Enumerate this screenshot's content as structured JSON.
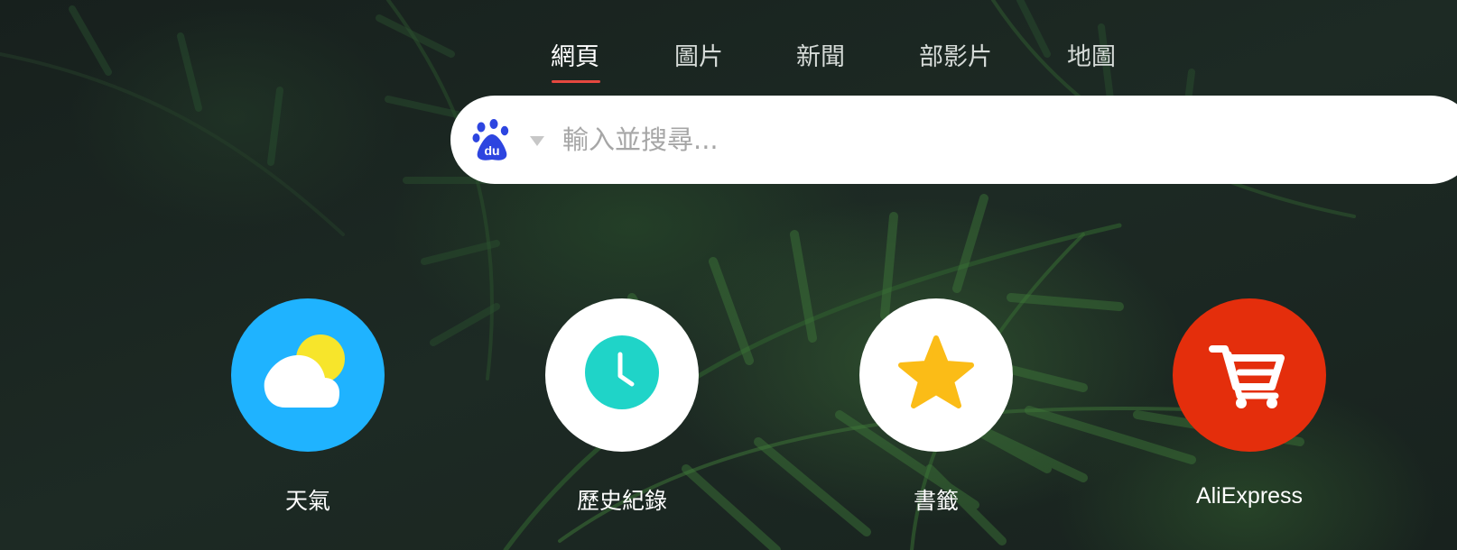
{
  "tabs": [
    {
      "label": "網頁",
      "active": true
    },
    {
      "label": "圖片",
      "active": false
    },
    {
      "label": "新聞",
      "active": false
    },
    {
      "label": "部影片",
      "active": false
    },
    {
      "label": "地圖",
      "active": false
    }
  ],
  "search": {
    "engine": "baidu",
    "engine_icon": "baidu-paw-icon",
    "placeholder": "輸入並搜尋...",
    "value": ""
  },
  "shortcuts": [
    {
      "label": "天氣",
      "icon": "weather-icon",
      "color": "#1fb3ff"
    },
    {
      "label": "歷史紀錄",
      "icon": "clock-icon",
      "color": "#ffffff"
    },
    {
      "label": "書籤",
      "icon": "star-icon",
      "color": "#ffffff"
    },
    {
      "label": "AliExpress",
      "icon": "cart-icon",
      "color": "#e42e0c"
    }
  ],
  "colors": {
    "tab_underline": "#e5483f",
    "baidu_blue": "#2d45e0",
    "clock_teal": "#1fd4c8",
    "star_yellow": "#fbbc17"
  }
}
